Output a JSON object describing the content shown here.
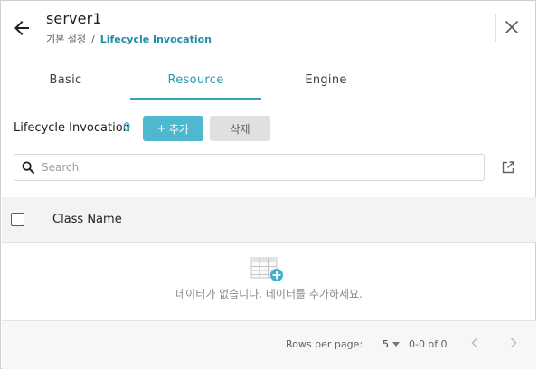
{
  "header": {
    "title": "server1",
    "breadcrumb": {
      "parent": "기본 설정",
      "separator": "/",
      "current": "Lifecycle Invocation"
    }
  },
  "tabs": [
    {
      "label": "Basic",
      "active": false
    },
    {
      "label": "Resource",
      "active": true
    },
    {
      "label": "Engine",
      "active": false
    }
  ],
  "toolbar": {
    "section_label": "Lifecycle Invocation",
    "count": "0",
    "add_label": "추가",
    "delete_label": "삭제"
  },
  "search": {
    "placeholder": "Search",
    "value": ""
  },
  "table": {
    "columns": [
      "Class Name"
    ],
    "rows": [],
    "empty_message": "데이터가 없습니다. 데이터를 추가하세요."
  },
  "pagination": {
    "rows_per_page_label": "Rows per page:",
    "rows_per_page": "5",
    "range": "0-0 of 0"
  },
  "icons": {
    "back": "arrow-left-icon",
    "close": "close-icon",
    "add": "plus-icon",
    "search": "search-icon",
    "open_new": "open-in-new-icon",
    "empty": "empty-table-icon",
    "prev": "chevron-left-icon",
    "next": "chevron-right-icon"
  },
  "colors": {
    "accent": "#2fa4bf",
    "add_button": "#4fb8d1",
    "breadcrumb_current": "#1f8fa6",
    "delete_button": "#e0e0e0"
  }
}
